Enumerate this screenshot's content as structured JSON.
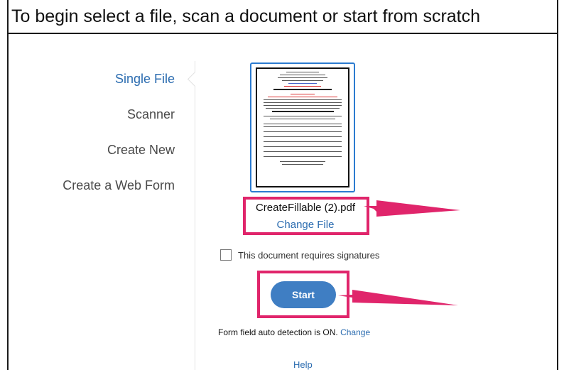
{
  "header": {
    "title": "To begin select a file, scan a document or start from scratch"
  },
  "nav": {
    "items": [
      {
        "label": "Single File",
        "active": true
      },
      {
        "label": "Scanner",
        "active": false
      },
      {
        "label": "Create New",
        "active": false
      },
      {
        "label": "Create a Web Form",
        "active": false
      }
    ]
  },
  "file": {
    "name": "CreateFillable (2).pdf",
    "change_label": "Change File"
  },
  "signatures": {
    "label": "This document requires signatures",
    "checked": false
  },
  "start": {
    "label": "Start"
  },
  "auto_detection": {
    "text": "Form field auto detection is ON.",
    "change_label": "Change"
  },
  "help": {
    "label": "Help"
  },
  "colors": {
    "accent": "#2b6cb0",
    "button": "#3f7ec3",
    "annotation": "#e0256b"
  }
}
